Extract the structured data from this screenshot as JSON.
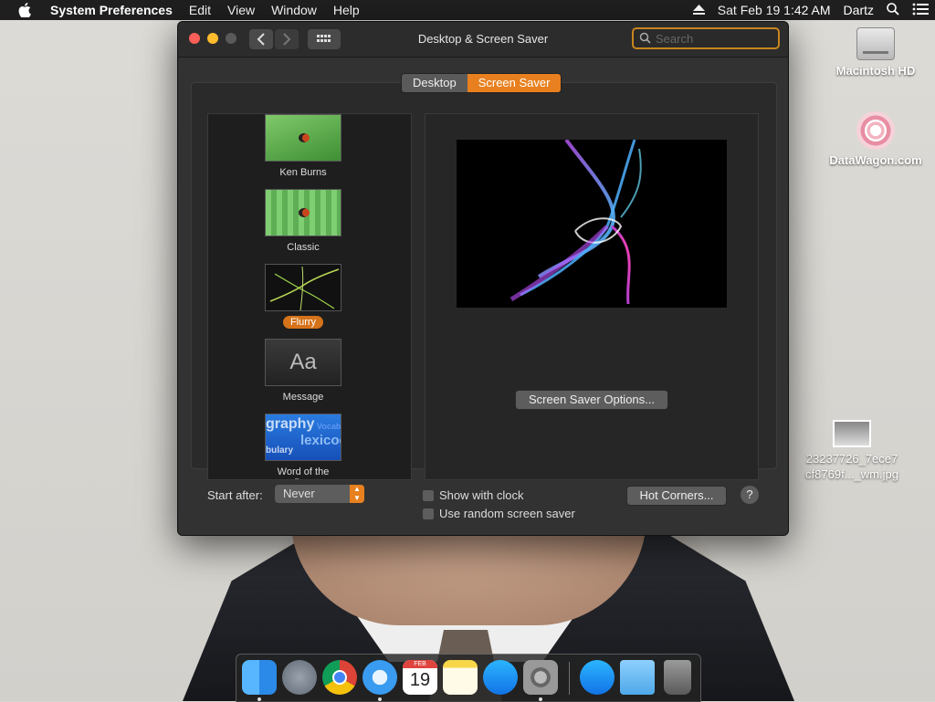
{
  "menubar": {
    "app_name": "System Preferences",
    "menus": [
      "Edit",
      "View",
      "Window",
      "Help"
    ],
    "clock": "Sat Feb 19  1:42 AM",
    "user": "Dartz"
  },
  "desktop": {
    "icons": [
      {
        "label": "Macintosh HD",
        "icon": "hard-drive-icon"
      },
      {
        "label": "DataWagon.com",
        "icon": "datawagon-icon"
      },
      {
        "label_line1": "23237726_7ece7",
        "label_line2": "cf8769f..._wm.jpg",
        "icon": "image-file-icon"
      }
    ]
  },
  "window": {
    "title": "Desktop & Screen Saver",
    "search_placeholder": "Search",
    "tabs": {
      "desktop": "Desktop",
      "screen_saver": "Screen Saver"
    },
    "selected_tab": "Screen Saver",
    "savers": [
      {
        "name": "Ken Burns"
      },
      {
        "name": "Classic"
      },
      {
        "name": "Flurry",
        "selected": true
      },
      {
        "name": "Message",
        "thumb_text": "Aa"
      },
      {
        "name": "Word of the Day",
        "thumb_words": [
          "graphy",
          "lexicog",
          "bulary",
          "Vocab"
        ]
      }
    ],
    "options_button": "Screen Saver Options...",
    "start_after_label": "Start after:",
    "start_after_value": "Never",
    "show_clock_label": "Show with clock",
    "random_label": "Use random screen saver",
    "hot_corners_button": "Hot Corners...",
    "help_button": "?"
  },
  "dock": {
    "apps": [
      "Finder",
      "Launchpad",
      "Chrome",
      "Safari",
      "Calendar",
      "Notes",
      "App Store",
      "System Preferences",
      "App Store",
      "Downloads",
      "Trash"
    ],
    "calendar_month": "FEB",
    "calendar_day": "19"
  },
  "colors": {
    "accent": "#e8801f",
    "window_bg": "#323232",
    "menubar": "#1f1f1f"
  }
}
